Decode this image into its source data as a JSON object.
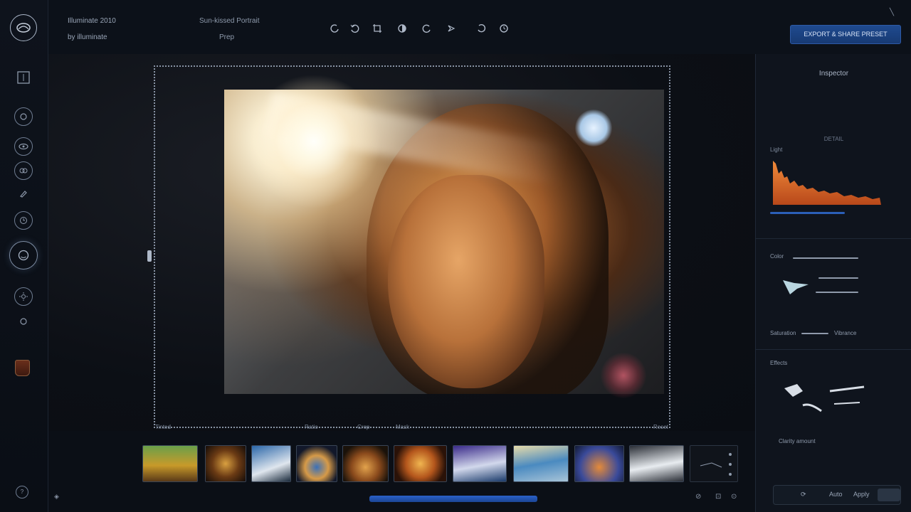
{
  "app": {
    "file_name": "Illuminate 2010",
    "file_sub": "by illuminate",
    "doc_title": "Sun-kissed Portrait",
    "doc_sub": "Prep"
  },
  "toolbar": {
    "primary_button": "EXPORT & SHARE PRESET",
    "icons": [
      "rotate-left-icon",
      "undo-icon",
      "crop-icon",
      "adjust-icon",
      "redo-icon",
      "compass-icon",
      "history-icon",
      "refresh-icon"
    ]
  },
  "rail": {
    "tools": [
      "layers-icon",
      "brightness-icon",
      "eye-icon",
      "filter-icon",
      "brush-icon",
      "clock-icon",
      "face-icon",
      "settings-icon",
      "sync-icon"
    ],
    "swatch_color": "#6a2f1b"
  },
  "canvas": {
    "frame_labels": [
      "Tinted",
      "Ratio",
      "Crop",
      "Mask",
      "Reset"
    ]
  },
  "panel": {
    "title": "Inspector",
    "histogram_caption": "DETAIL",
    "histogram_label": "Light",
    "section2_label": "Color",
    "section2_footer_left": "Saturation",
    "section2_footer_right": "Vibrance",
    "section3_label": "Effects",
    "section3_footer": "Clarity amount",
    "bottom_controls": {
      "label_1": "Auto",
      "label_2": "Apply"
    }
  },
  "colors": {
    "accent": "#1f4a8f",
    "scrollbar": "#2a61c8",
    "histogram_fill": "#e06a28"
  },
  "filmstrip": {
    "count": 11
  }
}
